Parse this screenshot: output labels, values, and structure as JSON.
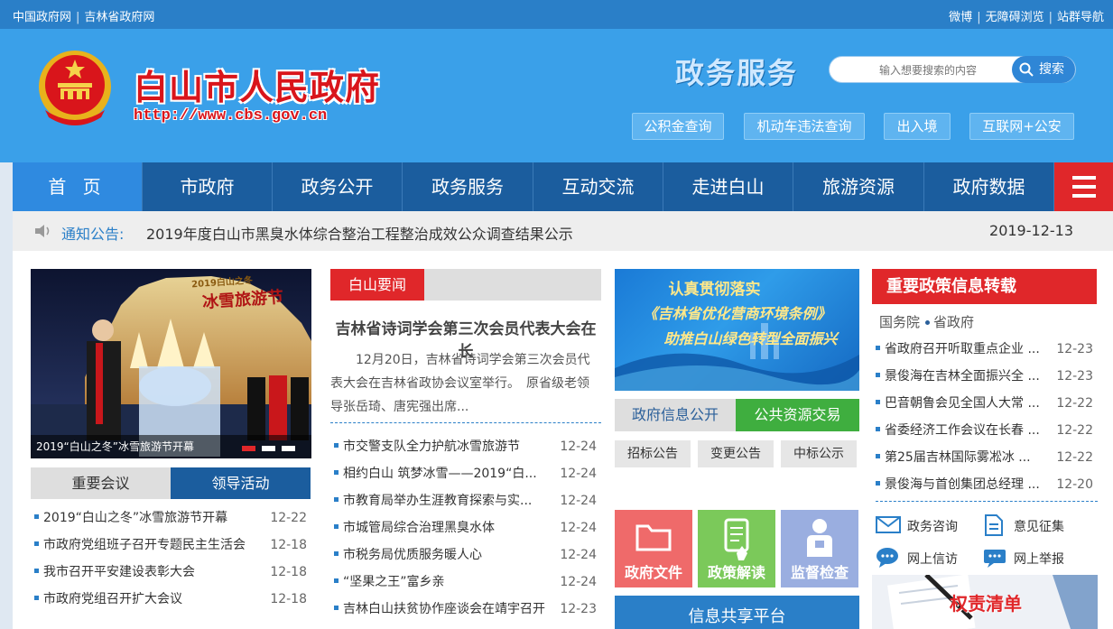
{
  "topbar": {
    "left_links": [
      "中国政府网",
      "吉林省政府网"
    ],
    "right_links": [
      "微博",
      "无障碍浏览",
      "站群导航"
    ]
  },
  "header": {
    "site_title": "白山市人民政府",
    "site_url": "http://www.cbs.gov.cn",
    "service_title": "政务服务",
    "search_placeholder": "输入想要搜索的内容",
    "search_button": "搜索",
    "quick_buttons": [
      "公积金查询",
      "机动车违法查询",
      "出入境",
      "互联网+公安"
    ]
  },
  "nav": {
    "items": [
      "首 页",
      "市政府",
      "政务公开",
      "政务服务",
      "互动交流",
      "走进白山",
      "旅游资源",
      "政府数据"
    ],
    "active": 0
  },
  "notice": {
    "label": "通知公告:",
    "text": "2019年度白山市黑臭水体综合整治工程整治成效公众调查结果公示",
    "date": "2019-12-13"
  },
  "slideshow": {
    "caption": "2019“白山之冬”冰雪旅游节开幕",
    "banner_lines": [
      "2019白山之冬",
      "冰雪旅游节"
    ],
    "active_dot": 0
  },
  "meetings": {
    "tabs": [
      "重要会议",
      "领导活动"
    ],
    "active_tab": 1,
    "items": [
      {
        "title": "2019“白山之冬”冰雪旅游节开幕",
        "date": "12-22"
      },
      {
        "title": "市政府党组班子召开专题民主生活会",
        "date": "12-18"
      },
      {
        "title": "我市召开平安建设表彰大会",
        "date": "12-18"
      },
      {
        "title": "市政府党组召开扩大会议",
        "date": "12-18"
      }
    ]
  },
  "news": {
    "tab": "白山要闻",
    "headline": "吉林省诗词学会第三次会员代表大会在长",
    "summary": "12月20日，吉林省诗词学会第三次会员代表大会在吉林省政协会议室举行。　原省级老领导张岳琦、唐宪强出席...",
    "items": [
      {
        "title": "市交警支队全力护航冰雪旅游节",
        "date": "12-24"
      },
      {
        "title": "相约白山 筑梦冰雪——2019“白...",
        "date": "12-24"
      },
      {
        "title": "市教育局举办生涯教育探索与实...",
        "date": "12-24"
      },
      {
        "title": "市城管局综合治理黑臭水体",
        "date": "12-24"
      },
      {
        "title": "市税务局优质服务暖人心",
        "date": "12-24"
      },
      {
        "title": "“坚果之王”富乡亲",
        "date": "12-24"
      },
      {
        "title": "吉林白山扶贫协作座谈会在靖宇召开",
        "date": "12-23"
      }
    ]
  },
  "promo_banner": {
    "line1": "认真贯彻落实",
    "line2": "《吉林省优化营商环境条例》",
    "line3": "助推白山绿色转型全面振兴"
  },
  "info_tabs": {
    "tabs": [
      "政府信息公开",
      "公共资源交易"
    ],
    "active_tab": 1,
    "buttons": [
      "招标公告",
      "变更公告",
      "中标公示"
    ]
  },
  "tiles": [
    {
      "label": "政府文件",
      "icon": "folder-icon",
      "color": "#ef6a6a"
    },
    {
      "label": "政策解读",
      "icon": "document-hand-icon",
      "color": "#7bc95a"
    },
    {
      "label": "监督检查",
      "icon": "person-icon",
      "color": "#9aaee0"
    }
  ],
  "share_platform": "信息共享平台",
  "policy": {
    "title": "重要政策信息转载",
    "sub_tabs": [
      "国务院",
      "省政府"
    ],
    "items": [
      {
        "title": "省政府召开听取重点企业 ...",
        "date": "12-23"
      },
      {
        "title": "景俊海在吉林全面振兴全 ...",
        "date": "12-23"
      },
      {
        "title": "巴音朝鲁会见全国人大常 ...",
        "date": "12-22"
      },
      {
        "title": "省委经济工作会议在长春 ...",
        "date": "12-22"
      },
      {
        "title": "第25届吉林国际雾凇冰 ...",
        "date": "12-22"
      },
      {
        "title": "景俊海与首创集团总经理 ...",
        "date": "12-20"
      }
    ]
  },
  "services": [
    {
      "label": "政务咨询",
      "icon": "mail-icon"
    },
    {
      "label": "意见征集",
      "icon": "form-icon"
    },
    {
      "label": "网上信访",
      "icon": "chat-icon"
    },
    {
      "label": "网上举报",
      "icon": "report-icon"
    }
  ],
  "quick_link_banner": "权责清单",
  "colors": {
    "topbar": "#2a7fc8",
    "header": "#3aa0e9",
    "nav": "#1b5d9e",
    "nav_active": "#2f8ae0",
    "accent_red": "#e0272a",
    "accent_green": "#3fae3f"
  }
}
